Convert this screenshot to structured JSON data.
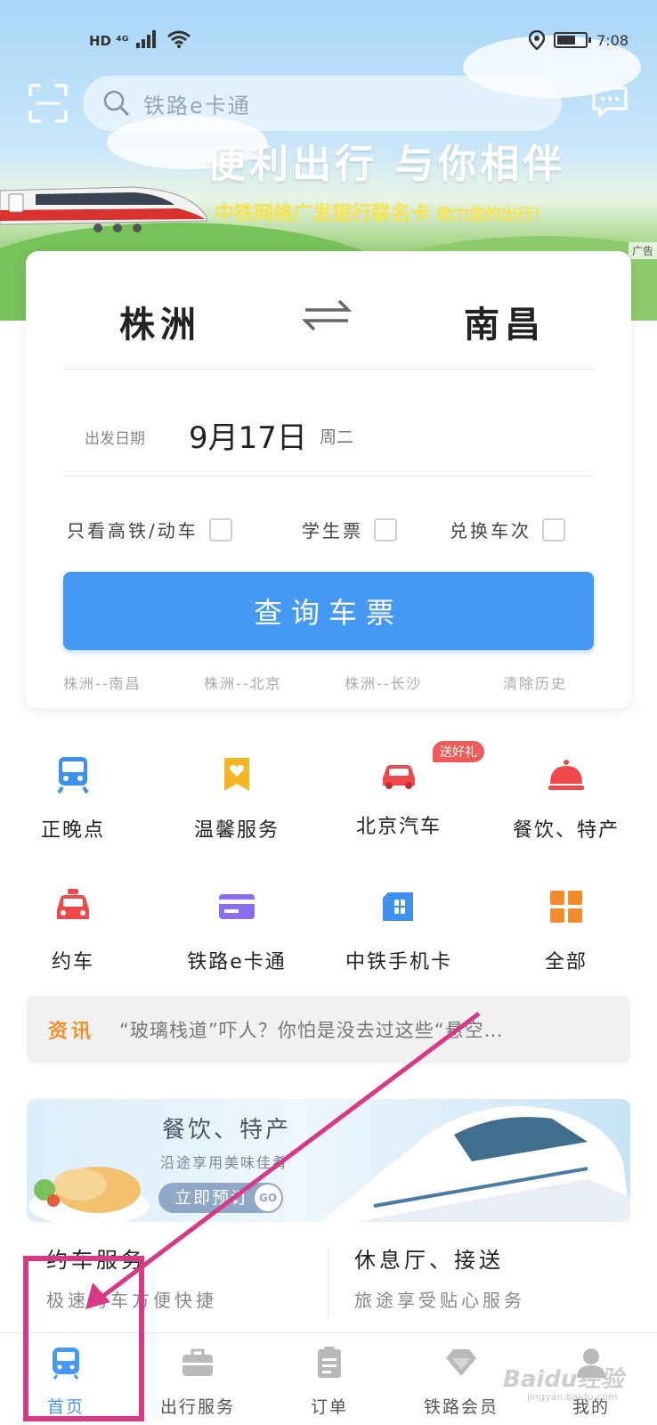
{
  "status_bar": {
    "network_left": "HD ⁴ᴳ",
    "time": "7:08"
  },
  "header": {
    "search_placeholder": "铁路e卡通",
    "banner_title": "便利出行  与你相伴",
    "banner_subtitle": "中铁网络广发银行联名卡",
    "banner_subtitle_tail": "助力您的出行！",
    "ad_tag": "广告"
  },
  "search": {
    "from_city": "株洲",
    "to_city": "南昌",
    "date_label": "出发日期",
    "date_value": "9月17日",
    "weekday": "周二",
    "options": [
      {
        "label": "只看高铁/动车"
      },
      {
        "label": "学生票"
      },
      {
        "label": "兑换车次"
      }
    ],
    "query_button": "查询车票",
    "history": [
      "株洲--南昌",
      "株洲--北京",
      "株洲--长沙"
    ],
    "clear_history": "清除历史"
  },
  "services": [
    {
      "label": "正晚点",
      "icon": "train-icon",
      "color": "#3d8ff0"
    },
    {
      "label": "温馨服务",
      "icon": "bookmark-heart-icon",
      "color": "#f6b624"
    },
    {
      "label": "北京汽车",
      "icon": "car-icon",
      "color": "#f04848",
      "badge": "送好礼"
    },
    {
      "label": "餐饮、特产",
      "icon": "food-cover-icon",
      "color": "#f04848"
    },
    {
      "label": "约车",
      "icon": "taxi-icon",
      "color": "#f04848"
    },
    {
      "label": "铁路e卡通",
      "icon": "card-icon",
      "color": "#8a6ef0"
    },
    {
      "label": "中铁手机卡",
      "icon": "sim-card-icon",
      "color": "#3d8ff0"
    },
    {
      "label": "全部",
      "icon": "grid-icon",
      "color": "#f38b2a"
    }
  ],
  "news": {
    "tag": "资讯",
    "text": "“玻璃栈道”吓人？你怕是没去过这些“悬空…"
  },
  "promo": {
    "title": "餐饮、特产",
    "subtitle": "沿途享用美味佳肴",
    "button": "立即预订",
    "go": "GO"
  },
  "cards": [
    {
      "title": "约车服务",
      "subtitle": "极速约车方便快捷"
    },
    {
      "title": "休息厅、接送",
      "subtitle": "旅途享受贴心服务"
    }
  ],
  "tabs": [
    {
      "label": "首页",
      "icon": "home-train-icon",
      "active": true
    },
    {
      "label": "出行服务",
      "icon": "briefcase-icon",
      "active": false
    },
    {
      "label": "订单",
      "icon": "order-icon",
      "active": false
    },
    {
      "label": "铁路会员",
      "icon": "diamond-icon",
      "active": false
    },
    {
      "label": "我的",
      "icon": "profile-icon",
      "active": false
    }
  ],
  "watermark": {
    "text": "Baidu经验",
    "sub": "jingyan.baidu.com"
  },
  "colors": {
    "accent": "#4599f5",
    "annotation": "#d63a86",
    "news_tag": "#f2922c"
  }
}
